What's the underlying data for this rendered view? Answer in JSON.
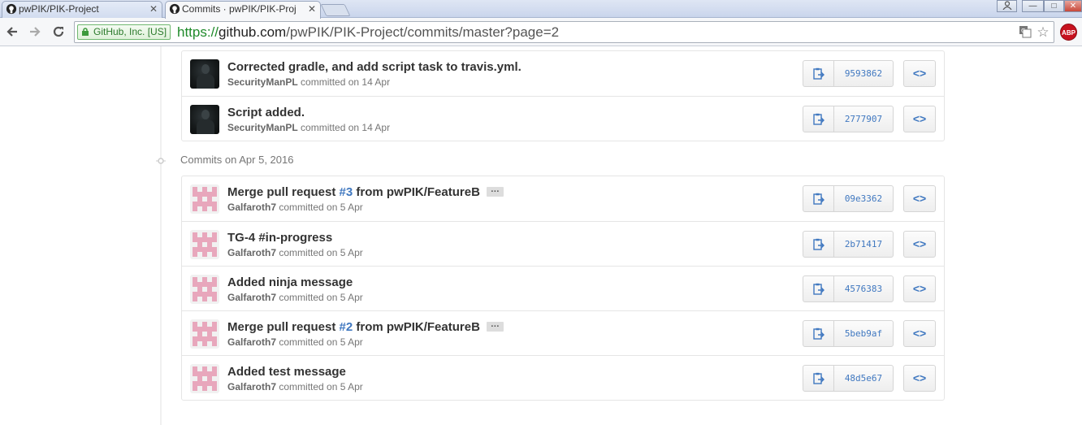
{
  "browser": {
    "tabs": [
      {
        "title": "pwPIK/PIK-Project",
        "close": "✕"
      },
      {
        "title": "Commits · pwPIK/PIK-Proj",
        "close": "✕"
      }
    ],
    "ev_label": "GitHub, Inc. [US]",
    "url_scheme": "https://",
    "url_host": "github.com",
    "url_path": "/pwPIK/PIK-Project/commits/master?page=2",
    "abp_label": "ABP",
    "window_controls": [
      "—",
      "□",
      "✕"
    ]
  },
  "groups": [
    {
      "header": "",
      "commits": [
        {
          "title": "Corrected gradle, and add script task to travis.yml.",
          "author": "SecurityManPL",
          "meta": "committed on 14 Apr",
          "sha": "9593862",
          "avatar": "dark"
        },
        {
          "title": "Script added.",
          "author": "SecurityManPL",
          "meta": "committed on 14 Apr",
          "sha": "2777907",
          "avatar": "dark"
        }
      ]
    },
    {
      "header": "Commits on Apr 5, 2016",
      "commits": [
        {
          "title_pre": "Merge pull request ",
          "issue": "#3",
          "title_post": " from pwPIK/FeatureB",
          "ellipsis": "…",
          "author": "Galfaroth7",
          "meta": "committed on 5 Apr",
          "sha": "09e3362",
          "avatar": "identicon"
        },
        {
          "title": "TG-4 #in-progress",
          "author": "Galfaroth7",
          "meta": "committed on 5 Apr",
          "sha": "2b71417",
          "avatar": "identicon"
        },
        {
          "title": "Added ninja message",
          "author": "Galfaroth7",
          "meta": "committed on 5 Apr",
          "sha": "4576383",
          "avatar": "identicon"
        },
        {
          "title_pre": "Merge pull request ",
          "issue": "#2",
          "title_post": " from pwPIK/FeatureB",
          "ellipsis": "…",
          "author": "Galfaroth7",
          "meta": "committed on 5 Apr",
          "sha": "5beb9af",
          "avatar": "identicon"
        },
        {
          "title": "Added test message",
          "author": "Galfaroth7",
          "meta": "committed on 5 Apr",
          "sha": "48d5e67",
          "avatar": "identicon"
        }
      ]
    }
  ],
  "browse_label": "<>",
  "colors": {
    "link": "#4078c0",
    "identicon": "#e8a7bc",
    "ev_green": "#2b7a2b"
  }
}
